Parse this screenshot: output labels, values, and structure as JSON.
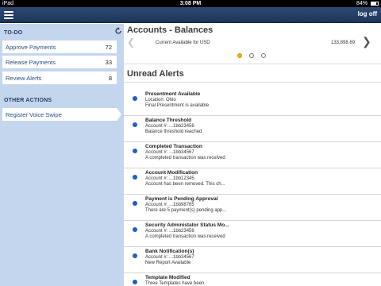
{
  "status_bar": {
    "carrier": "iPad",
    "time": "3:08 PM",
    "battery": "84%"
  },
  "nav": {
    "logoff_label": "log off"
  },
  "sidebar": {
    "todo_title": "TO-DO",
    "todo_items": [
      {
        "label": "Approve Payments",
        "count": "72"
      },
      {
        "label": "Release Payments",
        "count": "33"
      },
      {
        "label": "Review Alerts",
        "count": "8"
      }
    ],
    "other_title": "OTHER ACTIONS",
    "other_items": [
      {
        "label": "Register Voice Swipe"
      }
    ]
  },
  "balances": {
    "title": "Accounts - Balances",
    "label": "Current Available for USD",
    "value": "133,898.69",
    "page_count": 3,
    "active_page": 1
  },
  "alerts": {
    "title": "Unread Alerts",
    "items": [
      {
        "title": "Presentment Available",
        "line1": "Location: Ohio",
        "line2": "Final Presentment is available"
      },
      {
        "title": "Balance Threshold",
        "line1": "Account #: ...1bb23456",
        "line2": "Balance threshold reached"
      },
      {
        "title": "Completed Transaction",
        "line1": "Account #: ...1bb34567",
        "line2": "A completed transaction was received"
      },
      {
        "title": "Account Modification",
        "line1": "Account #: ...1bb12345",
        "line2": "Account has been removed. This ch..."
      },
      {
        "title": "Payment is Pending Approval",
        "line1": "Account #: ...1bb98765",
        "line2": "There are 5 payment(s) pending app..."
      },
      {
        "title": "Security Administator Status Mo...",
        "line1": "Account #: ...1bb23456",
        "line2": "A completed transaction was received"
      },
      {
        "title": "Bank Notification(s)",
        "line1": "Account #: ...1bb34567",
        "line2": "New Report Available"
      },
      {
        "title": "Template Modified",
        "line1": "Three Templates have been",
        "line2": ""
      }
    ]
  },
  "colors": {
    "nav": "#1d3558",
    "sidebar": "#c4d6ee",
    "accent_dot": "#f5b10c",
    "bullet": "#1d5fc0"
  },
  "icons": {
    "menu": "hamburger-icon",
    "refresh": "refresh-icon",
    "prev": "chevron-left-icon",
    "next": "chevron-right-icon"
  }
}
